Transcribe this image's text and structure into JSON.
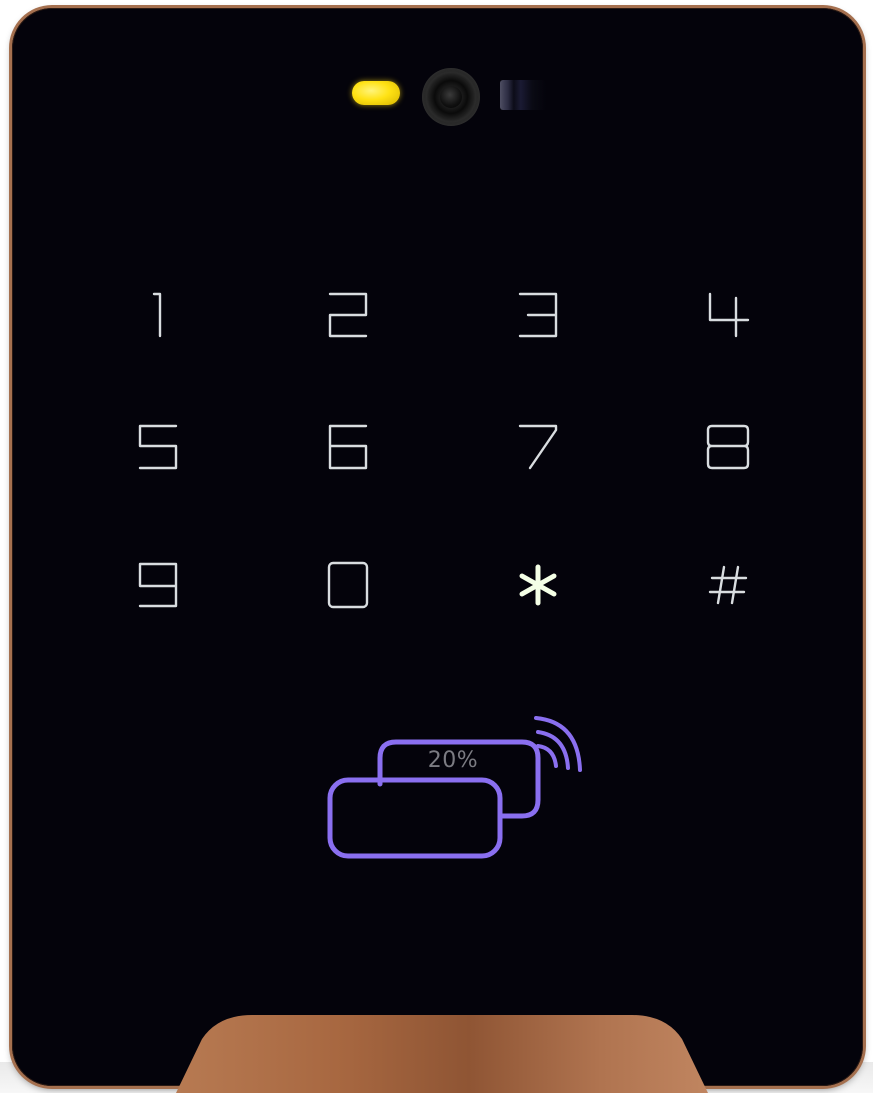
{
  "device": {
    "colors": {
      "body": "#04030b",
      "trim": "#a5704f",
      "status_led": "#ffe214",
      "key_glyph": "#d9dde0",
      "rfid_icon": "#8a6ff0"
    },
    "indicators": {
      "status_led_icon": "status-led-icon",
      "camera_icon": "camera-icon",
      "sensor_icon": "ir-sensor-icon"
    }
  },
  "keypad": {
    "keys": [
      {
        "label": "1",
        "icon": "digit-1-icon"
      },
      {
        "label": "2",
        "icon": "digit-2-icon"
      },
      {
        "label": "3",
        "icon": "digit-3-icon"
      },
      {
        "label": "4",
        "icon": "digit-4-icon"
      },
      {
        "label": "5",
        "icon": "digit-5-icon"
      },
      {
        "label": "6",
        "icon": "digit-6-icon"
      },
      {
        "label": "7",
        "icon": "digit-7-icon"
      },
      {
        "label": "8",
        "icon": "digit-8-icon"
      },
      {
        "label": "9",
        "icon": "digit-9-icon"
      },
      {
        "label": "0",
        "icon": "digit-0-icon"
      },
      {
        "label": "*",
        "icon": "asterisk-icon"
      },
      {
        "label": "#",
        "icon": "hash-icon"
      }
    ]
  },
  "rfid": {
    "icon": "rfid-card-icon",
    "progress_text": "20%",
    "progress": 0.2
  }
}
